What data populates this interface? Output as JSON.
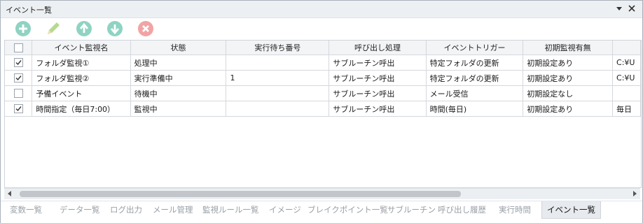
{
  "window": {
    "title": "イベント一覧"
  },
  "toolbar": {
    "buttons": [
      {
        "icon": "plus-icon",
        "color": "#8fd3c2"
      },
      {
        "icon": "pencil-icon",
        "color": "#b8d98f"
      },
      {
        "icon": "arrow-up-icon",
        "color": "#8fd3c2"
      },
      {
        "icon": "arrow-down-icon",
        "color": "#8fd3c2"
      },
      {
        "icon": "delete-icon",
        "color": "#f2a3a3"
      }
    ]
  },
  "table": {
    "columns": [
      "",
      "イベント監視名",
      "状態",
      "実行待ち番号",
      "呼び出し処理",
      "イベントトリガー",
      "初期監視有無",
      ""
    ],
    "rows": [
      {
        "checked": true,
        "name": "フォルダ監視①",
        "status": "処理中",
        "queue": "",
        "call": "サブルーチン呼出",
        "trigger": "特定フォルダの更新",
        "initial": "初期設定あり",
        "extra": "C:¥U"
      },
      {
        "checked": true,
        "name": "フォルダ監視②",
        "status": "実行準備中",
        "queue": "1",
        "call": "サブルーチン呼出",
        "trigger": "特定フォルダの更新",
        "initial": "初期設定あり",
        "extra": "C:¥U"
      },
      {
        "checked": false,
        "name": "予備イベント",
        "status": "待機中",
        "queue": "",
        "call": "サブルーチン呼出",
        "trigger": "メール受信",
        "initial": "初期設定なし",
        "extra": ""
      },
      {
        "checked": true,
        "name": "時間指定（毎日7:00）",
        "status": "監視中",
        "queue": "",
        "call": "サブルーチン呼出",
        "trigger": "時間(毎日)",
        "initial": "初期設定あり",
        "extra": "毎日"
      }
    ]
  },
  "tabs": [
    {
      "label": "変数一覧",
      "active": false
    },
    {
      "label": "データ一覧",
      "active": false
    },
    {
      "label": "ログ出力",
      "active": false
    },
    {
      "label": "メール管理",
      "active": false
    },
    {
      "label": "監視ルール一覧",
      "active": false
    },
    {
      "label": "イメージ",
      "active": false
    },
    {
      "label": "ブレイクポイント一覧",
      "active": false
    },
    {
      "label": "サブルーチン",
      "active": false
    },
    {
      "label": "呼び出し履歴",
      "active": false
    },
    {
      "label": "実行時間",
      "active": false
    },
    {
      "label": "イベント一覧",
      "active": true
    }
  ]
}
